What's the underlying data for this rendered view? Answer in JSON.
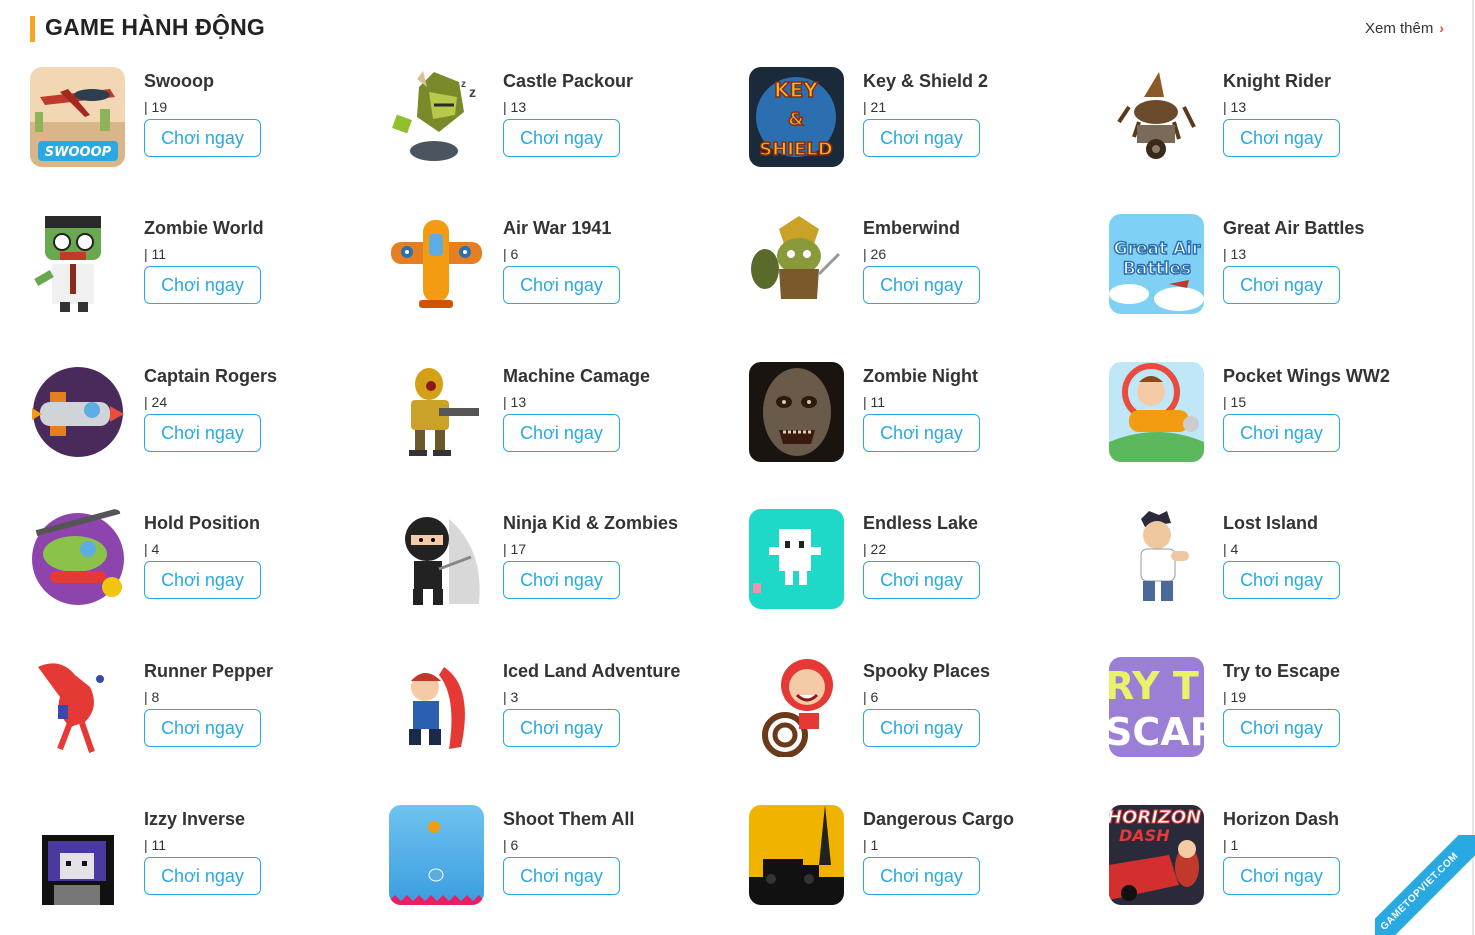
{
  "section": {
    "title": "GAME HÀNH ĐỘNG",
    "more_label": "Xem thêm",
    "accent_color": "#f5a623",
    "button_color": "#29a9e1"
  },
  "play_label": "Chơi ngay",
  "watermark": "GAMETOPVIET.COM",
  "games": [
    {
      "name": "Swooop",
      "count": "| 19",
      "thumb": "swooop"
    },
    {
      "name": "Castle Packour",
      "count": "| 13",
      "thumb": "castle"
    },
    {
      "name": "Key & Shield 2",
      "count": "| 21",
      "thumb": "keyshield"
    },
    {
      "name": "Knight Rider",
      "count": "| 13",
      "thumb": "knight"
    },
    {
      "name": "Zombie World",
      "count": "| 11",
      "thumb": "zombieworld"
    },
    {
      "name": "Air War 1941",
      "count": "| 6",
      "thumb": "airwar"
    },
    {
      "name": "Emberwind",
      "count": "| 26",
      "thumb": "emberwind"
    },
    {
      "name": "Great Air Battles",
      "count": "| 13",
      "thumb": "greatair"
    },
    {
      "name": "Captain Rogers",
      "count": "| 24",
      "thumb": "captain"
    },
    {
      "name": "Machine Camage",
      "count": "| 13",
      "thumb": "machine"
    },
    {
      "name": "Zombie Night",
      "count": "| 11",
      "thumb": "zombienight"
    },
    {
      "name": "Pocket Wings WW2",
      "count": "| 15",
      "thumb": "pocketwings"
    },
    {
      "name": "Hold Position",
      "count": "| 4",
      "thumb": "holdposition"
    },
    {
      "name": "Ninja Kid & Zombies",
      "count": "| 17",
      "thumb": "ninja"
    },
    {
      "name": "Endless Lake",
      "count": "| 22",
      "thumb": "endlesslake"
    },
    {
      "name": "Lost Island",
      "count": "| 4",
      "thumb": "lostisland"
    },
    {
      "name": "Runner Pepper",
      "count": "| 8",
      "thumb": "pepper"
    },
    {
      "name": "Iced Land Adventure",
      "count": "| 3",
      "thumb": "icedland"
    },
    {
      "name": "Spooky Places",
      "count": "| 6",
      "thumb": "spooky"
    },
    {
      "name": "Try to Escape",
      "count": "| 19",
      "thumb": "escape"
    },
    {
      "name": "Izzy Inverse",
      "count": "| 11",
      "thumb": "izzy"
    },
    {
      "name": "Shoot Them All",
      "count": "| 6",
      "thumb": "shoot"
    },
    {
      "name": "Dangerous Cargo",
      "count": "| 1",
      "thumb": "cargo"
    },
    {
      "name": "Horizon Dash",
      "count": "| 1",
      "thumb": "horizon"
    }
  ]
}
